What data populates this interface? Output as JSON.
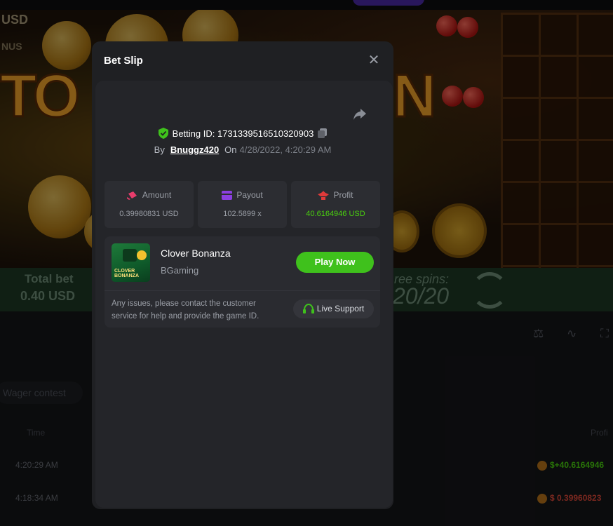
{
  "background": {
    "currency_code": "USD",
    "bonus_fragment": "NUS",
    "title_left_fragment": "TO",
    "title_right_fragment": "N",
    "total_bet_label": "Total bet",
    "total_bet_value": "0.40 USD",
    "free_spins_label": "ree spins:",
    "free_spins_value": "20/20",
    "wager_contest_label": "Wager contest",
    "table": {
      "col_time": "Time",
      "col_profit": "Profi",
      "rows": [
        {
          "time": "4:20:29 AM",
          "profit": "$+40.6164946",
          "color": "#4ad10f"
        },
        {
          "time": "4:18:34 AM",
          "profit": "$  0.39960823",
          "color": "#e04a3a"
        }
      ]
    }
  },
  "modal": {
    "title": "Bet Slip",
    "betting_id_label": "Betting ID: 1731339516510320903",
    "by_label": "By",
    "user": "Bnuggz420",
    "on_label": "On",
    "date": "4/28/2022, 4:20:29 AM",
    "stats": {
      "amount": {
        "label": "Amount",
        "value": "0.39980831 USD"
      },
      "payout": {
        "label": "Payout",
        "value": "102.5899 x"
      },
      "profit": {
        "label": "Profit",
        "value": "40.6164946 USD"
      }
    },
    "game": {
      "name": "Clover Bonanza",
      "provider": "BGaming",
      "thumb_text": "CLOVER BONANZA",
      "play_label": "Play Now"
    },
    "issue_text": "Any issues, please contact the customer service for help and provide the game ID.",
    "support_label": "Live Support"
  },
  "colors": {
    "accent_green": "#3fc11c",
    "profit_green": "#4ad10f",
    "amount_pink": "#e83c6c",
    "payout_purple": "#8b3fe0",
    "profit_red": "#e03a3a"
  }
}
